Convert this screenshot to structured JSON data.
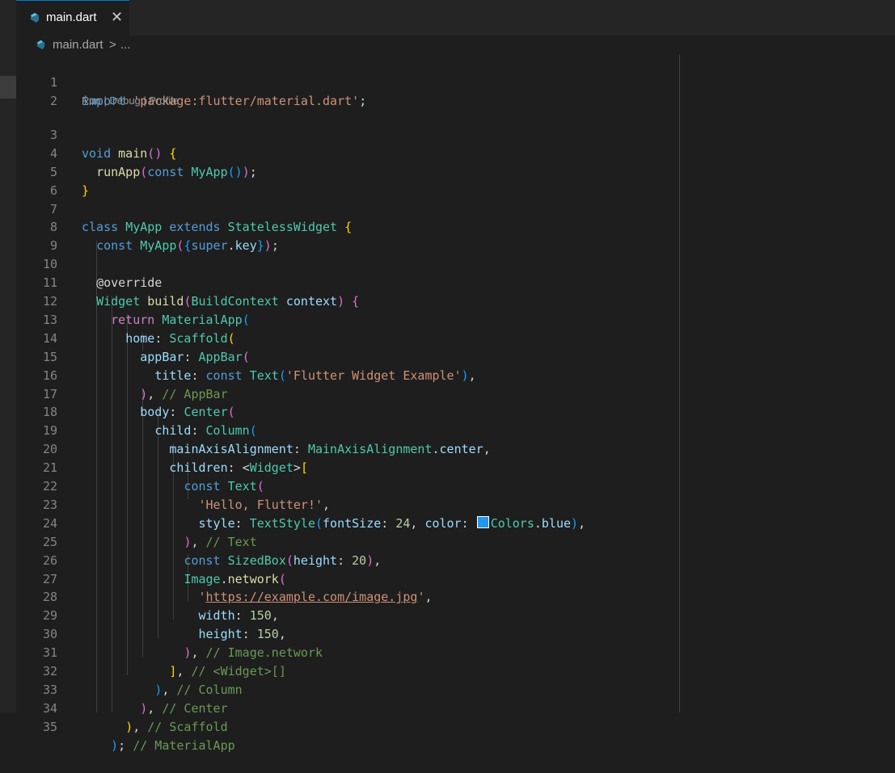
{
  "tab": {
    "name": "main.dart",
    "close_glyph": "✕"
  },
  "breadcrumb": {
    "file": "main.dart",
    "sep": ">",
    "rest": "..."
  },
  "codelens": {
    "run": "Run",
    "sep1": " | ",
    "debug": "Debug",
    "sep2": " | ",
    "profile": "Profile"
  },
  "line_numbers": [
    "1",
    "2",
    "3",
    "4",
    "5",
    "6",
    "7",
    "8",
    "9",
    "10",
    "11",
    "12",
    "13",
    "14",
    "15",
    "16",
    "17",
    "18",
    "19",
    "20",
    "21",
    "22",
    "23",
    "24",
    "25",
    "26",
    "27",
    "28",
    "29",
    "30",
    "31",
    "32",
    "33",
    "34",
    "35"
  ],
  "code": {
    "l1": [
      "import",
      " ",
      "'package:flutter/material.dart'",
      ";"
    ],
    "l3": [
      "void",
      " ",
      "main",
      "(",
      ")",
      " ",
      "{"
    ],
    "l4": [
      "  ",
      "runApp",
      "(",
      "const",
      " ",
      "MyApp",
      "(",
      ")",
      ")",
      ";"
    ],
    "l5": [
      "}"
    ],
    "l7": [
      "class",
      " ",
      "MyApp",
      " ",
      "extends",
      " ",
      "StatelessWidget",
      " ",
      "{"
    ],
    "l8": [
      "  ",
      "const",
      " ",
      "MyApp",
      "(",
      "{",
      "super",
      ".",
      "key",
      "}",
      ")",
      ";"
    ],
    "l10": [
      "  ",
      "@override"
    ],
    "l11": [
      "  ",
      "Widget",
      " ",
      "build",
      "(",
      "BuildContext",
      " ",
      "context",
      ")",
      " ",
      "{"
    ],
    "l12": [
      "    ",
      "return",
      " ",
      "MaterialApp",
      "("
    ],
    "l13": [
      "      ",
      "home",
      ": ",
      "Scaffold",
      "("
    ],
    "l14": [
      "        ",
      "appBar",
      ": ",
      "AppBar",
      "("
    ],
    "l15": [
      "          ",
      "title",
      ": ",
      "const",
      " ",
      "Text",
      "(",
      "'Flutter Widget Example'",
      ")",
      ","
    ],
    "l16": [
      "        ",
      ")",
      ", ",
      "// AppBar"
    ],
    "l17": [
      "        ",
      "body",
      ": ",
      "Center",
      "("
    ],
    "l18": [
      "          ",
      "child",
      ": ",
      "Column",
      "("
    ],
    "l19": [
      "            ",
      "mainAxisAlignment",
      ": ",
      "MainAxisAlignment",
      ".",
      "center",
      ","
    ],
    "l20": [
      "            ",
      "children",
      ": ",
      "<",
      "Widget",
      ">",
      "["
    ],
    "l21": [
      "              ",
      "const",
      " ",
      "Text",
      "("
    ],
    "l22": [
      "                ",
      "'Hello, Flutter!'",
      ","
    ],
    "l23": [
      "                ",
      "style",
      ": ",
      "TextStyle",
      "(",
      "fontSize",
      ": ",
      "24",
      ", ",
      "color",
      ": ",
      "Colors",
      ".",
      "blue",
      ")",
      ","
    ],
    "l24": [
      "              ",
      ")",
      ", ",
      "// Text"
    ],
    "l25": [
      "              ",
      "const",
      " ",
      "SizedBox",
      "(",
      "height",
      ": ",
      "20",
      ")",
      ","
    ],
    "l26": [
      "              ",
      "Image",
      ".",
      "network",
      "("
    ],
    "l27": [
      "                ",
      "'",
      "https://example.com/image.jpg",
      "'",
      ","
    ],
    "l28": [
      "                ",
      "width",
      ": ",
      "150",
      ","
    ],
    "l29": [
      "                ",
      "height",
      ": ",
      "150",
      ","
    ],
    "l30": [
      "              ",
      ")",
      ", ",
      "// Image.network"
    ],
    "l31": [
      "            ",
      "]",
      ", ",
      "// <Widget>[]"
    ],
    "l32": [
      "          ",
      ")",
      ", ",
      "// Column"
    ],
    "l33": [
      "        ",
      ")",
      ", ",
      "// Center"
    ],
    "l34": [
      "      ",
      ")",
      ", ",
      "// Scaffold"
    ],
    "l35": [
      "    ",
      ")",
      "; ",
      "// MaterialApp"
    ]
  },
  "colors": {
    "swatch": "#2196f3",
    "background": "#1e1e1e",
    "keyword": "#569cd6",
    "type": "#4ec9b0",
    "string": "#ce9178"
  }
}
